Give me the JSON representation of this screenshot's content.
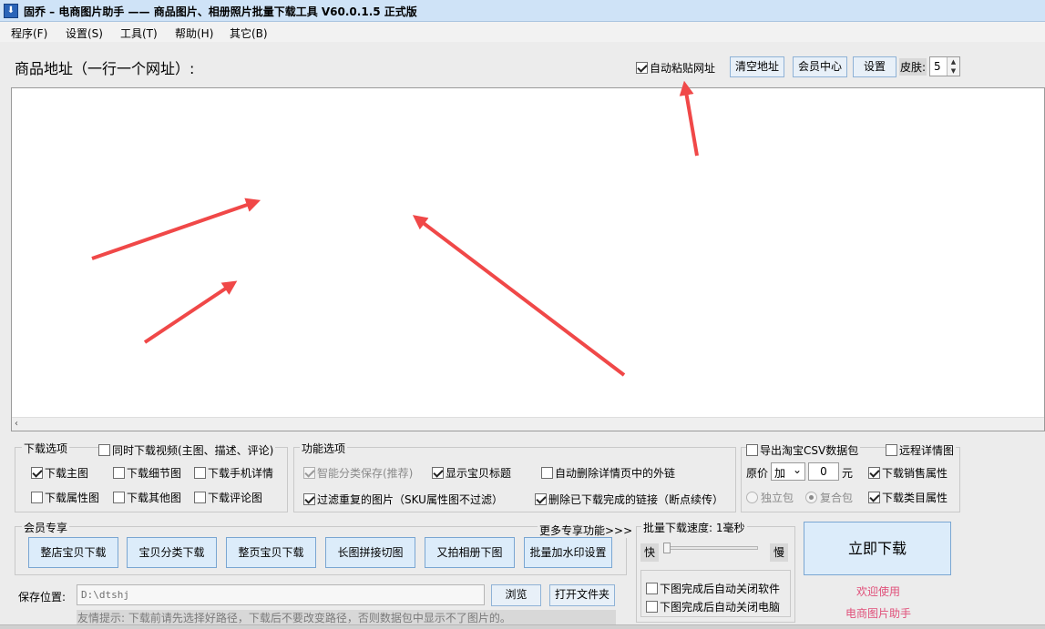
{
  "window": {
    "title": "固乔 – 电商图片助手 —— 商品图片、相册照片批量下载工具 V60.0.1.5 正式版",
    "icon_glyph": "⬇"
  },
  "menu": [
    "程序(F)",
    "设置(S)",
    "工具(T)",
    "帮助(H)",
    "其它(B)"
  ],
  "top": {
    "url_label": "商品地址（一行一个网址）:",
    "auto_paste": {
      "label": "自动粘贴网址",
      "checked": true
    },
    "clear_button": "清空地址",
    "member_center_button": "会员中心",
    "settings_button": "设置",
    "skin_label": "皮肤:",
    "skin_value": "5"
  },
  "download_options": {
    "title": "下载选项",
    "video_checkbox": "同时下载视频(主图、描述、评论)",
    "items": [
      {
        "label": "下载主图",
        "checked": true
      },
      {
        "label": "下载细节图",
        "checked": false
      },
      {
        "label": "下载手机详情",
        "checked": false
      },
      {
        "label": "下载属性图",
        "checked": false
      },
      {
        "label": "下载其他图",
        "checked": false
      },
      {
        "label": "下载评论图",
        "checked": false
      }
    ]
  },
  "function_options": {
    "title": "功能选项",
    "items": [
      {
        "label": "智能分类保存(推荐)",
        "checked": true,
        "disabled": true
      },
      {
        "label": "显示宝贝标题",
        "checked": true
      },
      {
        "label": "自动删除详情页中的外链",
        "checked": false
      },
      {
        "label": "过滤重复的图片（SKU属性图不过滤）",
        "checked": true
      },
      {
        "label": "删除已下载完成的链接（断点续传）",
        "checked": true
      }
    ]
  },
  "csv": {
    "export_label": "导出淘宝CSV数据包",
    "remote_detail_label": "远程详情图",
    "price_label": "原价",
    "price_op": "加",
    "price_value": "0",
    "price_unit": "元",
    "sales_attr_label": "下载销售属性",
    "category_attr_label": "下载类目属性",
    "radio_single": "独立包",
    "radio_combined": "复合包"
  },
  "member": {
    "title": "会员专享",
    "more_link": "更多专享功能>>>",
    "buttons": [
      "整店宝贝下载",
      "宝贝分类下载",
      "整页宝贝下载",
      "长图拼接切图",
      "又拍相册下图",
      "批量加水印设置"
    ]
  },
  "speed": {
    "title": "批量下载速度: 1毫秒",
    "fast": "快",
    "slow": "慢",
    "close_software": "下图完成后自动关闭软件",
    "shutdown": "下图完成后自动关闭电脑"
  },
  "start_button": "立即下载",
  "welcome": "欢迎使用",
  "app_name": "电商图片助手",
  "save": {
    "label": "保存位置:",
    "path": "D:\\dtshj",
    "browse_button": "浏览",
    "open_folder_button": "打开文件夹",
    "tip": "友情提示: 下载前请先选择好路径，下载后不要改变路径，否则数据包中显示不了图片的。"
  },
  "colors": {
    "annotation_arrow": "#f04848",
    "button_border": "#8fb2d6",
    "pink_text": "#e0507a"
  },
  "icons": {
    "scroll_left": "‹",
    "spin_up": "▲",
    "spin_down": "▼",
    "dropdown": "⌄"
  }
}
